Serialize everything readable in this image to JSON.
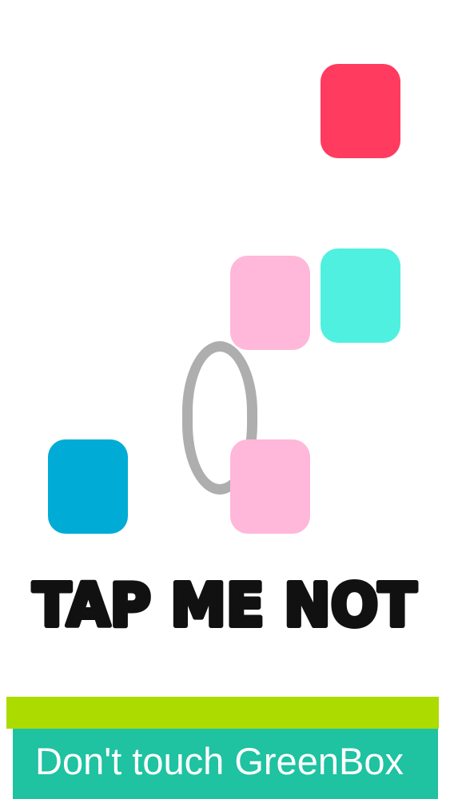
{
  "colors": {
    "background": "#ffffff",
    "tile_red": "#ff3b60",
    "tile_pink": "#ffb8d9",
    "tile_cyan": "#4ff0df",
    "tile_blue": "#00acd6",
    "ring": "#aeaeae",
    "title": "#111111",
    "strip_lime": "#acdb00",
    "banner_teal": "#1fc2a1",
    "banner_text": "#ffffff"
  },
  "game": {
    "title": "TAP ME NOT"
  },
  "banner": {
    "text": "Don't touch GreenBox"
  }
}
